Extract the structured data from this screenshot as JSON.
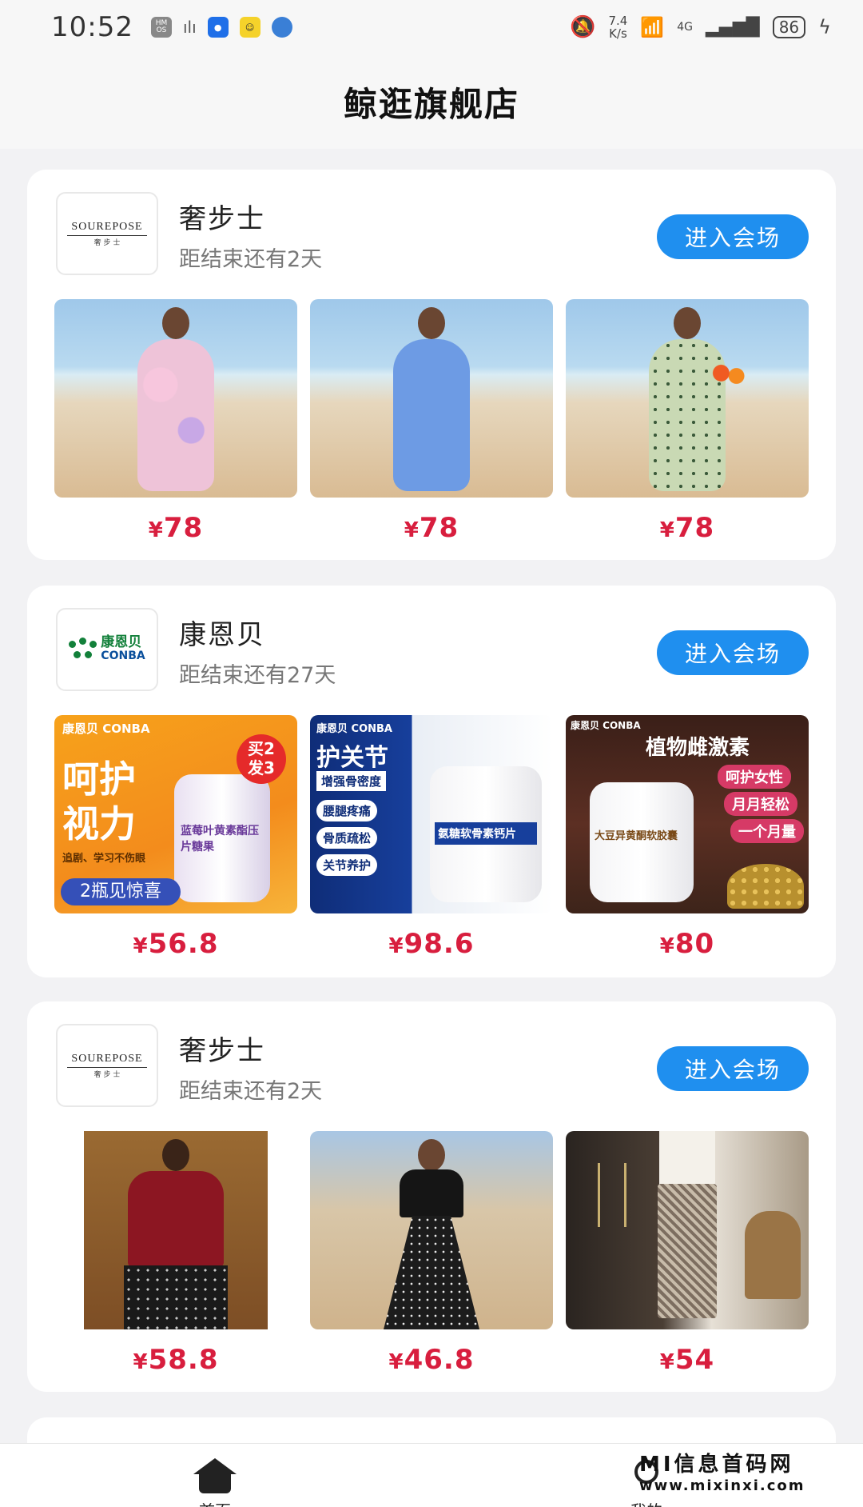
{
  "status_bar": {
    "time": "10:52",
    "hm_badge": "HM OS",
    "net_speed_value": "7.4",
    "net_speed_unit": "K/s",
    "network": "4G",
    "battery": "86"
  },
  "page": {
    "title": "鲸逛旗舰店"
  },
  "cards": [
    {
      "brand": "奢步士",
      "logo_text": "SOUREPOSE",
      "logo_sub": "奢 步 士",
      "countdown": "距结束还有2天",
      "button_label": "进入会场",
      "products": [
        {
          "currency": "¥",
          "price": "78",
          "image": "floral-dress-beach"
        },
        {
          "currency": "¥",
          "price": "78",
          "image": "blue-dress-beach"
        },
        {
          "currency": "¥",
          "price": "78",
          "image": "green-dotted-dress"
        }
      ]
    },
    {
      "brand": "康恩贝",
      "logo_cn": "康恩贝",
      "logo_en": "CONBA",
      "countdown": "距结束还有27天",
      "button_label": "进入会场",
      "products": [
        {
          "currency": "¥",
          "price": "56.8",
          "image": "blueberry-lutein-candy",
          "texts": {
            "brand": "康恩贝 CONBA",
            "headline1": "呵护",
            "headline2": "视力",
            "badge1": "买2",
            "badge2": "发3",
            "product": "蓝莓叶黄素酯压片糖果",
            "tagline": "追剧、学习不伤眼",
            "promo": "2瓶见惊喜"
          }
        },
        {
          "currency": "¥",
          "price": "98.6",
          "image": "joint-calcium-tablets",
          "texts": {
            "brand": "康恩贝 CONBA",
            "headline": "护关节",
            "sub": "增强骨密度",
            "item1": "腰腿疼痛",
            "item2": "骨质疏松",
            "item3": "关节养护",
            "product": "氨糖软骨素钙片"
          }
        },
        {
          "currency": "¥",
          "price": "80",
          "image": "soy-isoflavone-capsules",
          "texts": {
            "brand": "康恩贝 CONBA",
            "headline": "植物雌激素",
            "tag1": "呵护女性",
            "tag2": "月月轻松",
            "tag3": "一个月量",
            "product": "大豆异黄酮软胶囊"
          }
        }
      ]
    },
    {
      "brand": "奢步士",
      "logo_text": "SOUREPOSE",
      "logo_sub": "奢 步 士",
      "countdown": "距结束还有2天",
      "button_label": "进入会场",
      "products": [
        {
          "currency": "¥",
          "price": "58.8",
          "image": "red-bow-blouse"
        },
        {
          "currency": "¥",
          "price": "46.8",
          "image": "black-top-floral-skirt"
        },
        {
          "currency": "¥",
          "price": "54",
          "image": "plaid-trousers"
        }
      ]
    }
  ],
  "bottom_nav": {
    "items": [
      {
        "label": "首页",
        "icon": "home-icon"
      },
      {
        "label": "我的",
        "icon": "user-icon"
      }
    ]
  },
  "watermark": {
    "title": "MI信息首码网",
    "url": "www.mixinxi.com"
  },
  "colors": {
    "accent": "#1f8fef",
    "price": "#d81e3e",
    "background": "#f2f2f4"
  }
}
